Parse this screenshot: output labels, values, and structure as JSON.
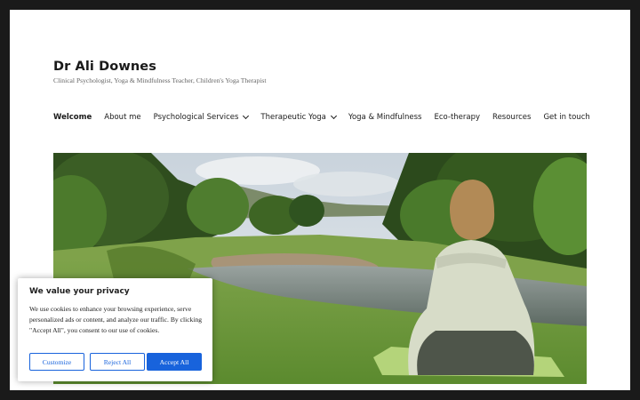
{
  "site": {
    "title": "Dr Ali Downes",
    "tagline": "Clinical Psychologist, Yoga & Mindfulness Teacher, Children's Yoga Therapist"
  },
  "nav": {
    "items": [
      {
        "label": "Welcome"
      },
      {
        "label": "About me"
      },
      {
        "label": "Psychological Services"
      },
      {
        "label": "Therapeutic Yoga"
      },
      {
        "label": "Yoga & Mindfulness"
      },
      {
        "label": "Eco-therapy"
      },
      {
        "label": "Resources"
      },
      {
        "label": "Get in touch"
      }
    ]
  },
  "hero": {
    "icon": "woman-meditating-by-river-photo"
  },
  "cookie": {
    "title": "We value your privacy",
    "text": "We use cookies to enhance your browsing experience, serve personalized ads or content, and analyze our traffic. By clicking \"Accept All\", you consent to our use of cookies.",
    "customize": "Customize",
    "reject": "Reject All",
    "accept": "Accept All",
    "accent_color": "#1863dc"
  }
}
